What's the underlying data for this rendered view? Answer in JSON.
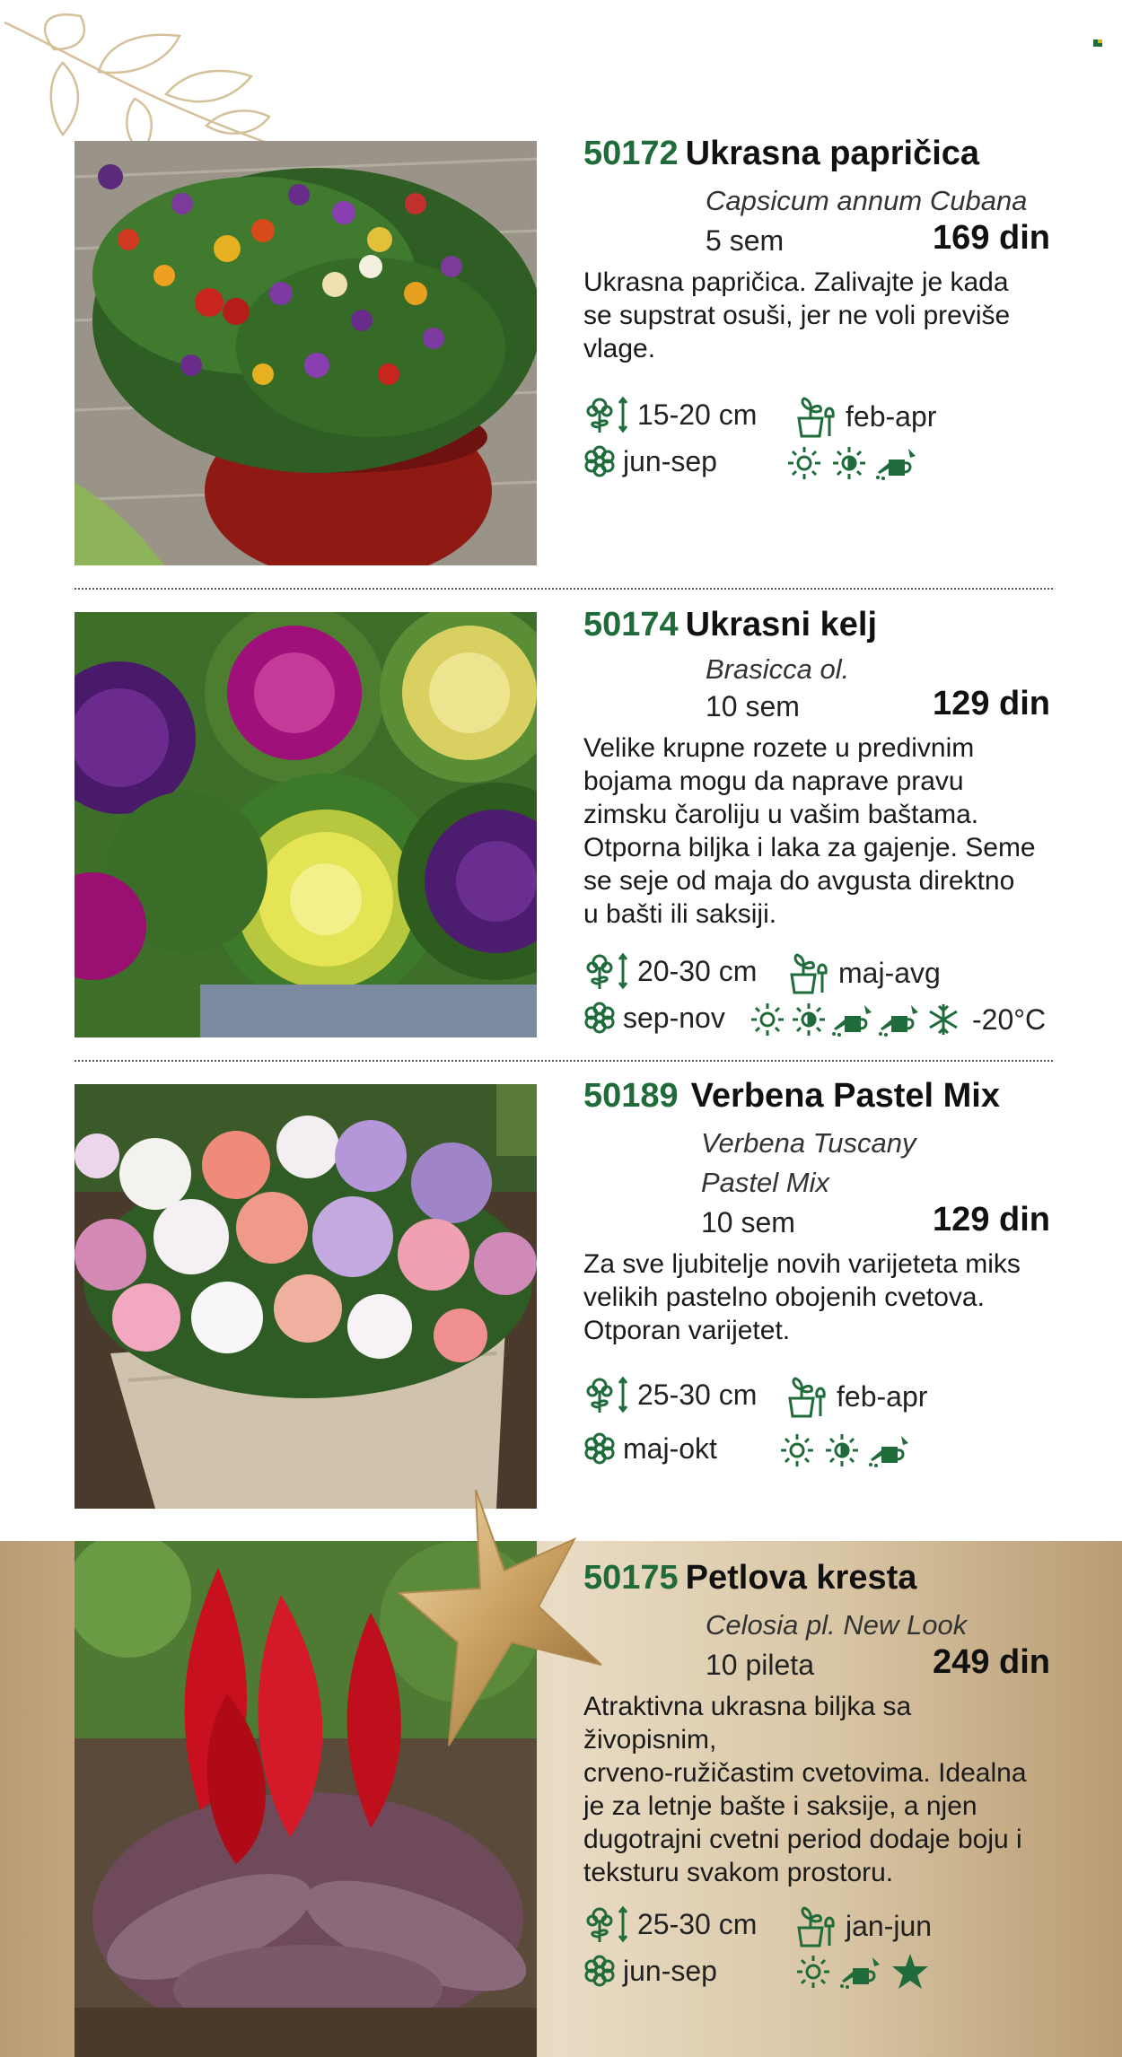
{
  "products": [
    {
      "code": "50172",
      "name": "Ukrasna papričica",
      "latin_lines": [
        "Capsicum annum Cubana"
      ],
      "quantity": "5 sem",
      "price": "169 din",
      "description_lines": [
        "Ukrasna papričica. Zalivajte je kada",
        "se supstrat osuši, jer ne voli previše",
        "vlage."
      ],
      "height": "15-20 cm",
      "sowing": "feb-apr",
      "flowering": "jun-sep",
      "care_icons": [
        "sun-icon",
        "half-shade-icon",
        "watering-can-icon"
      ],
      "temperature": ""
    },
    {
      "code": "50174",
      "name": "Ukrasni kelj",
      "latin_lines": [
        "Brasicca ol."
      ],
      "quantity": "10 sem",
      "price": "129 din",
      "description_lines": [
        "Velike krupne rozete u predivnim",
        "bojama mogu da naprave pravu",
        "zimsku čaroliju u vašim baštama.",
        "Otporna biljka i laka za gajenje. Seme",
        "se seje od maja do avgusta direktno",
        "u bašti ili saksiji."
      ],
      "height": "20-30 cm",
      "sowing": "maj-avg",
      "flowering": "sep-nov",
      "care_icons": [
        "sun-icon",
        "half-shade-icon",
        "watering-can-icon",
        "watering-can-icon",
        "frost-icon"
      ],
      "temperature": "-20°C"
    },
    {
      "code": "50189",
      "name": "Verbena Pastel Mix",
      "latin_lines": [
        "Verbena Tuscany",
        "Pastel Mix"
      ],
      "quantity": "10 sem",
      "price": "129 din",
      "description_lines": [
        "Za sve ljubitelje novih varijeteta miks",
        "velikih pastelno obojenih cvetova.",
        "Otporan varijetet."
      ],
      "height": "25-30 cm",
      "sowing": "feb-apr",
      "flowering": "maj-okt",
      "care_icons": [
        "sun-icon",
        "half-shade-icon",
        "watering-can-icon"
      ],
      "temperature": ""
    },
    {
      "code": "50175",
      "name": "Petlova kresta",
      "latin_lines": [
        "Celosia pl. New Look"
      ],
      "quantity": "10 pileta",
      "price": "249 din",
      "description_lines": [
        "Atraktivna ukrasna biljka sa živopisnim,",
        "crveno-ružičastim cvetovima. Idealna",
        "je za letnje bašte i saksije, a njen",
        "dugotrajni cvetni period dodaje boju i",
        "teksturu svakom prostoru."
      ],
      "height": "25-30 cm",
      "sowing": "jan-jun",
      "flowering": "jun-sep",
      "care_icons": [
        "sun-icon",
        "watering-can-icon",
        "star-icon"
      ],
      "temperature": ""
    }
  ],
  "colors": {
    "code_green": "#1f6b3a",
    "gold": "#cdb58c"
  }
}
